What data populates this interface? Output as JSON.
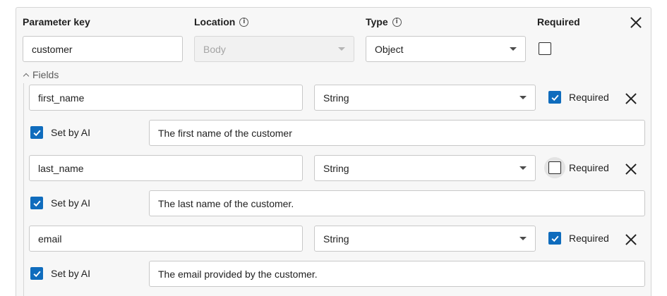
{
  "header": {
    "parameter_key_label": "Parameter key",
    "location_label": "Location",
    "type_label": "Type",
    "required_label": "Required"
  },
  "parameter": {
    "key_value": "customer",
    "location_value": "Body",
    "type_value": "Object",
    "required": false
  },
  "fields_toggle_label": "Fields",
  "fields": [
    {
      "name": "first_name",
      "type": "String",
      "required": true,
      "required_label": "Required",
      "set_by_ai": true,
      "set_by_ai_label": "Set by AI",
      "description": "The first name of the customer"
    },
    {
      "name": "last_name",
      "type": "String",
      "required": false,
      "required_label": "Required",
      "set_by_ai": true,
      "set_by_ai_label": "Set by AI",
      "description": "The last name of the customer."
    },
    {
      "name": "email",
      "type": "String",
      "required": true,
      "required_label": "Required",
      "set_by_ai": true,
      "set_by_ai_label": "Set by AI",
      "description": "The email provided by the customer."
    }
  ],
  "colors": {
    "accent": "#0f6cbd",
    "panel_bg": "#f7f7f7",
    "border": "#c8c8c8"
  },
  "icons": {
    "info": "info-icon",
    "close": "close-icon",
    "dropdown": "chevron-down-icon",
    "collapse": "chevron-up-icon",
    "check": "checkmark-icon"
  }
}
